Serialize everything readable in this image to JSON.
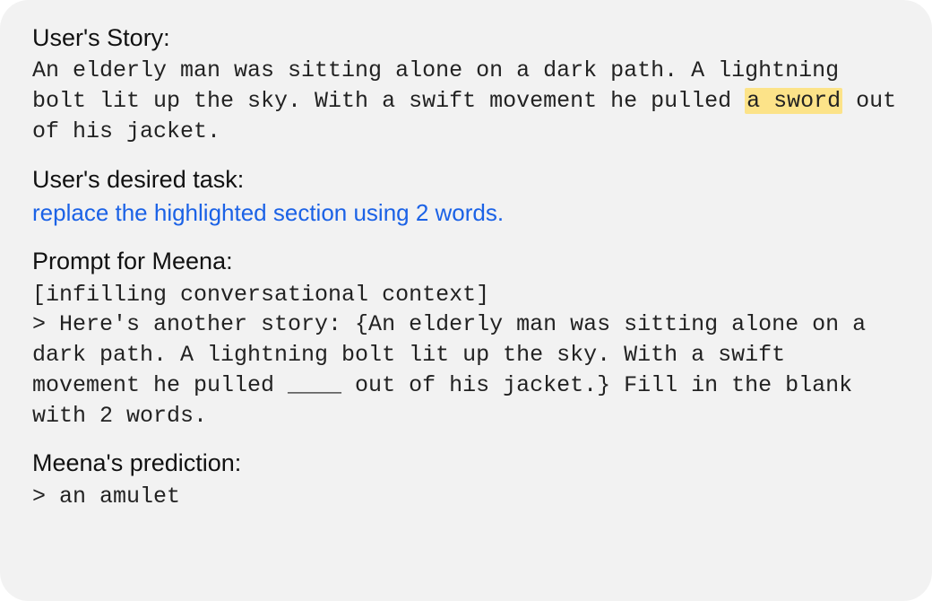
{
  "sections": {
    "story": {
      "heading": "User's Story:",
      "before": "An elderly man was sitting alone on a dark path. A lightning bolt lit up the sky. With a swift movement he pulled ",
      "highlight": "a sword",
      "after": " out of his jacket."
    },
    "task": {
      "heading": "User's desired task:",
      "text": "replace the highlighted section using 2 words."
    },
    "prompt": {
      "heading": "Prompt for Meena:",
      "context_line": "[infilling conversational context]",
      "body": "> Here's another story: {An elderly man was sitting alone on a dark path. A lightning bolt lit up the sky. With a swift movement he pulled ____ out of his jacket.} Fill in the blank with 2 words."
    },
    "prediction": {
      "heading": "Meena's prediction:",
      "text": "> an amulet"
    }
  }
}
